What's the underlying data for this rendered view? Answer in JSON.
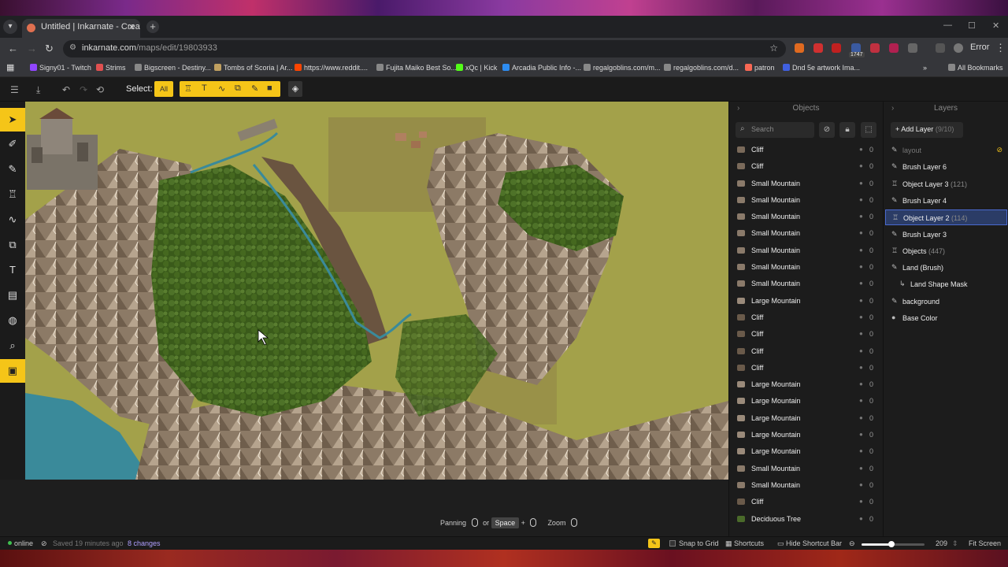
{
  "browser": {
    "tab_title": "Untitled | Inkarnate - Create Fa",
    "url_domain": "inkarnate.com",
    "url_path": "/maps/edit/19803933",
    "extension_badge": "1747",
    "error_label": "Error",
    "bookmarks": [
      {
        "label": "Signy01 - Twitch",
        "color": "#9146ff"
      },
      {
        "label": "Strims",
        "color": "#e05050"
      },
      {
        "label": "Bigscreen - Destiny...",
        "color": "#888888"
      },
      {
        "label": "Tombs of Scoria | Ar...",
        "color": "#c0a060"
      },
      {
        "label": "https://www.reddit....",
        "color": "#ff4500"
      },
      {
        "label": "Fujita Maiko Best So...",
        "color": "#888888"
      },
      {
        "label": "xQc | Kick",
        "color": "#53fc18"
      },
      {
        "label": "Arcadia Public Info -...",
        "color": "#2d8cf0"
      },
      {
        "label": "regalgoblins.com/m...",
        "color": "#888888"
      },
      {
        "label": "regalgoblins.com/d...",
        "color": "#888888"
      },
      {
        "label": "patron",
        "color": "#f96854"
      },
      {
        "label": "Dnd 5e artwork Ima...",
        "color": "#4060e0"
      }
    ],
    "all_bookmarks": "All Bookmarks"
  },
  "toolbar": {
    "select_label": "Select:",
    "all_label": "All"
  },
  "objects_panel": {
    "title": "Objects",
    "search_placeholder": "Search",
    "items": [
      {
        "name": "Cliff",
        "count": "0",
        "thumb": "#7a6a5a"
      },
      {
        "name": "Cliff",
        "count": "0",
        "thumb": "#7a6a5a"
      },
      {
        "name": "Small Mountain",
        "count": "0",
        "thumb": "#8a7a6a"
      },
      {
        "name": "Small Mountain",
        "count": "0",
        "thumb": "#8a7a6a"
      },
      {
        "name": "Small Mountain",
        "count": "0",
        "thumb": "#8a7a6a"
      },
      {
        "name": "Small Mountain",
        "count": "0",
        "thumb": "#8a7a6a"
      },
      {
        "name": "Small Mountain",
        "count": "0",
        "thumb": "#8a7a6a"
      },
      {
        "name": "Small Mountain",
        "count": "0",
        "thumb": "#8a7a6a"
      },
      {
        "name": "Small Mountain",
        "count": "0",
        "thumb": "#8a7a6a"
      },
      {
        "name": "Large Mountain",
        "count": "0",
        "thumb": "#9a8a7a"
      },
      {
        "name": "Cliff",
        "count": "0",
        "thumb": "#6a5a4a"
      },
      {
        "name": "Cliff",
        "count": "0",
        "thumb": "#6a5a4a"
      },
      {
        "name": "Cliff",
        "count": "0",
        "thumb": "#6a5a4a"
      },
      {
        "name": "Cliff",
        "count": "0",
        "thumb": "#6a5a4a"
      },
      {
        "name": "Large Mountain",
        "count": "0",
        "thumb": "#9a8a7a"
      },
      {
        "name": "Large Mountain",
        "count": "0",
        "thumb": "#9a8a7a"
      },
      {
        "name": "Large Mountain",
        "count": "0",
        "thumb": "#9a8a7a"
      },
      {
        "name": "Large Mountain",
        "count": "0",
        "thumb": "#9a8a7a"
      },
      {
        "name": "Large Mountain",
        "count": "0",
        "thumb": "#9a8a7a"
      },
      {
        "name": "Small Mountain",
        "count": "0",
        "thumb": "#8a7a6a"
      },
      {
        "name": "Small Mountain",
        "count": "0",
        "thumb": "#8a7a6a"
      },
      {
        "name": "Cliff",
        "count": "0",
        "thumb": "#6a5a4a"
      },
      {
        "name": "Deciduous Tree",
        "count": "0",
        "thumb": "#4a6a2a"
      }
    ]
  },
  "layers_panel": {
    "title": "Layers",
    "add_label": "Add Layer",
    "add_count": "(9/10)",
    "items": [
      {
        "name": "layout",
        "count": "",
        "icon": "✎",
        "dim": true,
        "hidden": true
      },
      {
        "name": "Brush Layer 6",
        "count": "",
        "icon": "✎"
      },
      {
        "name": "Object Layer 3",
        "count": "(121)",
        "icon": "♖"
      },
      {
        "name": "Brush Layer 4",
        "count": "",
        "icon": "✎"
      },
      {
        "name": "Object Layer 2",
        "count": "(114)",
        "icon": "♖",
        "selected": true
      },
      {
        "name": "Brush Layer 3",
        "count": "",
        "icon": "✎"
      },
      {
        "name": "Objects",
        "count": "(447)",
        "icon": "♖"
      },
      {
        "name": "Land (Brush)",
        "count": "",
        "icon": "✎"
      },
      {
        "name": "Land Shape Mask",
        "count": "",
        "icon": "↳",
        "sub": true
      },
      {
        "name": "background",
        "count": "",
        "icon": "✎"
      },
      {
        "name": "Base Color",
        "count": "",
        "icon": "●"
      }
    ]
  },
  "hints": {
    "panning": "Panning",
    "or": "or",
    "space": "Space",
    "plus": "+",
    "zoom": "Zoom"
  },
  "status": {
    "online": "online",
    "saved": "Saved 19 minutes ago",
    "changes": "8 changes",
    "snap": "Snap to Grid",
    "shortcuts": "Shortcuts",
    "hide_bar": "Hide Shortcut Bar",
    "zoom_value": "209",
    "zoom_fraction": 0.48,
    "fit": "Fit Screen"
  },
  "colors": {
    "accent": "#f5c518",
    "selection": "#2b3c66",
    "land": "#a3a14a",
    "water": "#3a7a9a",
    "forest": "#3a5a1a"
  }
}
